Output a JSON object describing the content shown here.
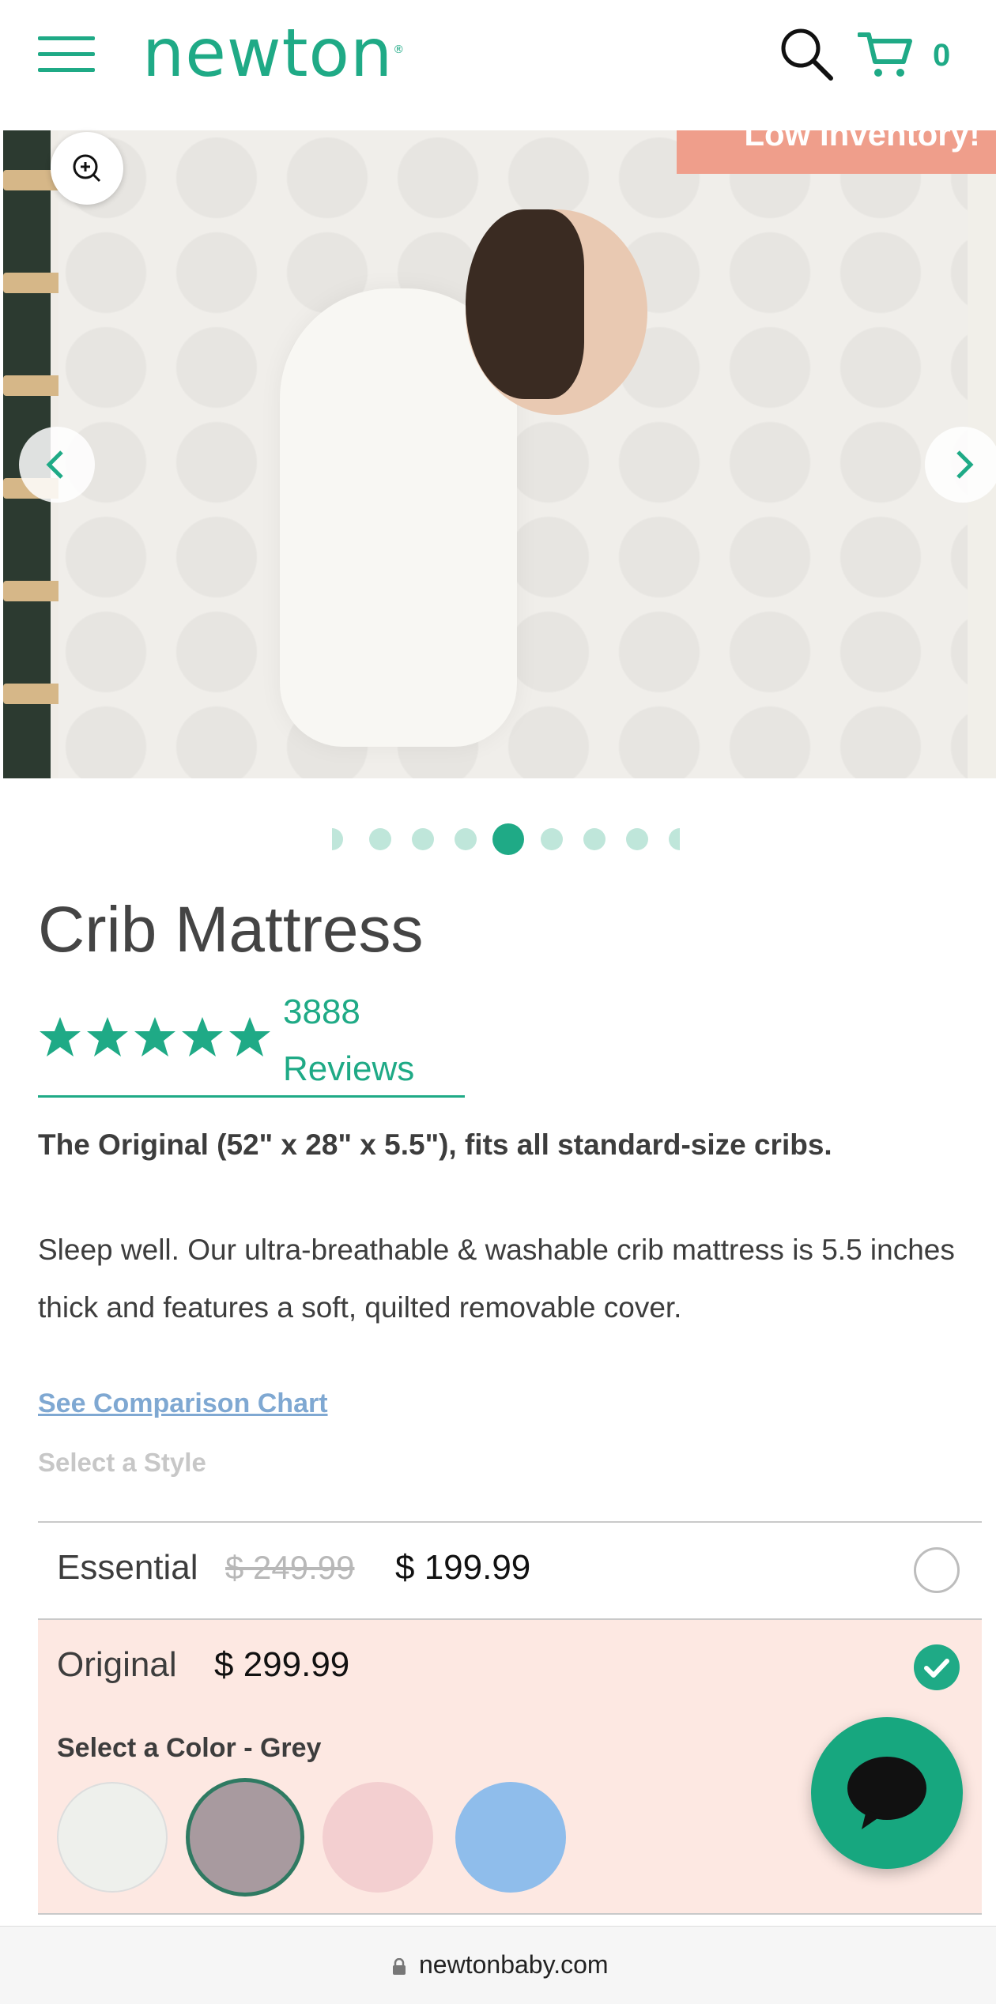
{
  "header": {
    "logo": "newton",
    "cart_count": "0"
  },
  "hero": {
    "banner": "Low Inventory!",
    "slides_total": 9,
    "active_slide": 5
  },
  "product": {
    "title": "Crib Mattress",
    "rating_stars": 5,
    "review_count": "3888",
    "review_word": "Reviews",
    "subtitle": "The Original (52\" x 28\" x 5.5\"), fits all standard-size cribs.",
    "description": "Sleep well. Our ultra-breathable & washable crib mattress is 5.5 inches thick and features a soft, quilted removable cover.",
    "comparison_link": "See Comparison Chart",
    "style_label": "Select a Style"
  },
  "options": [
    {
      "name": "Essential",
      "old_price": "$ 249.99",
      "price": "$ 199.99",
      "selected": false
    },
    {
      "name": "Original",
      "price": "$ 299.99",
      "selected": true
    }
  ],
  "color_select": {
    "label": "Select a Color - Grey",
    "swatches": [
      "#eef0ec",
      "#a89a9f",
      "#f3cfd0",
      "#8fbdeb"
    ],
    "selected_index": 1
  },
  "browser": {
    "url": "newtonbaby.com"
  },
  "colors": {
    "brand": "#1faa86",
    "selected_bg": "#fde8e2",
    "banner": "#ef9e8b",
    "link": "#7fa8d2"
  },
  "icons": [
    "menu-icon",
    "search-icon",
    "cart-icon",
    "zoom-icon",
    "chevron-left-icon",
    "chevron-right-icon",
    "star-icon",
    "check-icon",
    "chat-icon",
    "lock-icon"
  ]
}
